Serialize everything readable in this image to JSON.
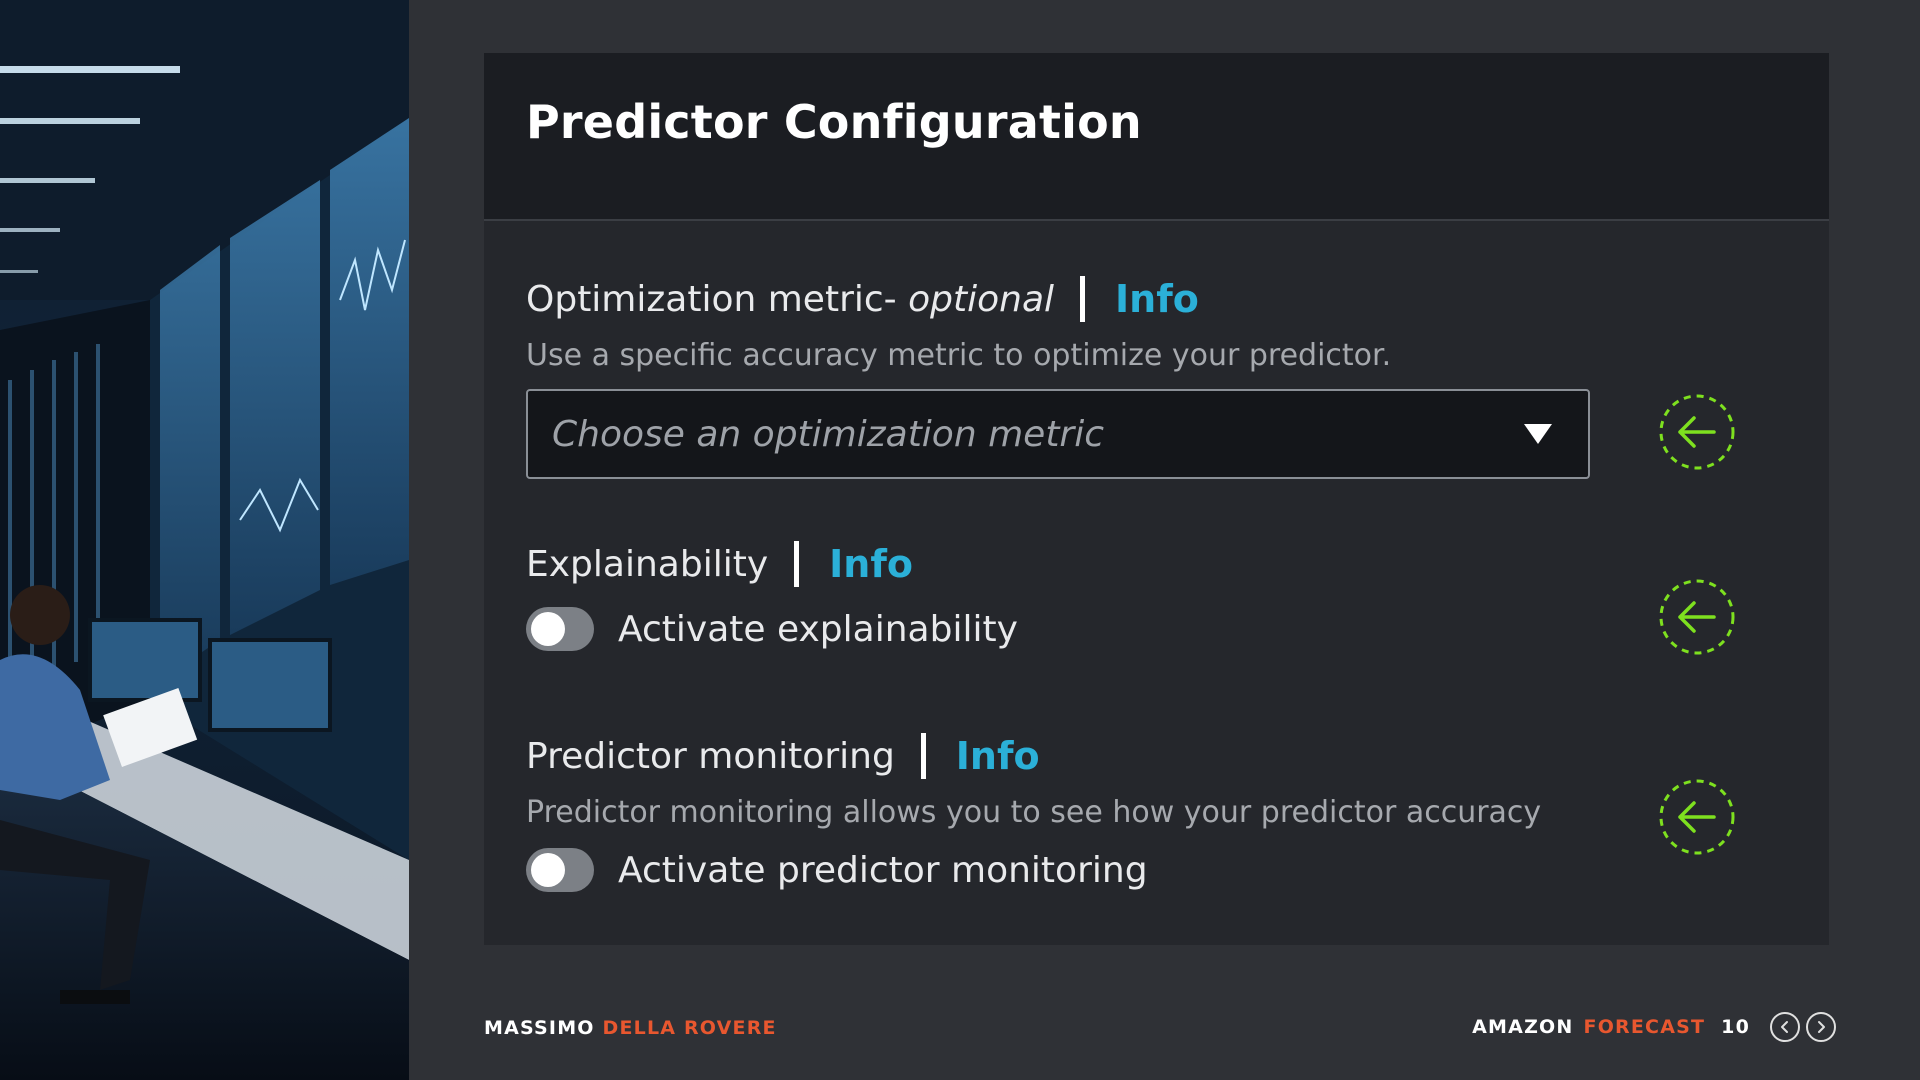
{
  "card": {
    "title": "Predictor Configuration"
  },
  "optimization": {
    "label": "Optimization metric-",
    "label_optional": "optional",
    "info": "Info",
    "description": "Use a specific accuracy metric to optimize your predictor.",
    "select_placeholder": "Choose an optimization metric"
  },
  "explainability": {
    "label": "Explainability",
    "info": "Info",
    "toggle_label": "Activate explainability",
    "toggle_on": false
  },
  "monitoring": {
    "label": "Predictor monitoring",
    "info": "Info",
    "description": "Predictor monitoring allows you to see how your predictor accuracy",
    "toggle_label": "Activate predictor monitoring",
    "toggle_on": false
  },
  "footer": {
    "author_first": "MASSIMO",
    "author_last": "DELLA ROVERE",
    "product_first": "AMAZON",
    "product_last": "FORECAST",
    "page_number": "10"
  },
  "colors": {
    "accent": "#e8572f",
    "info_link": "#2bb0d8",
    "marker_green": "#7ee01f"
  },
  "icons": {
    "marker": "arrow-left-dashed-circle-icon",
    "select": "caret-down-icon",
    "prev": "chevron-left-icon",
    "next": "chevron-right-icon"
  }
}
